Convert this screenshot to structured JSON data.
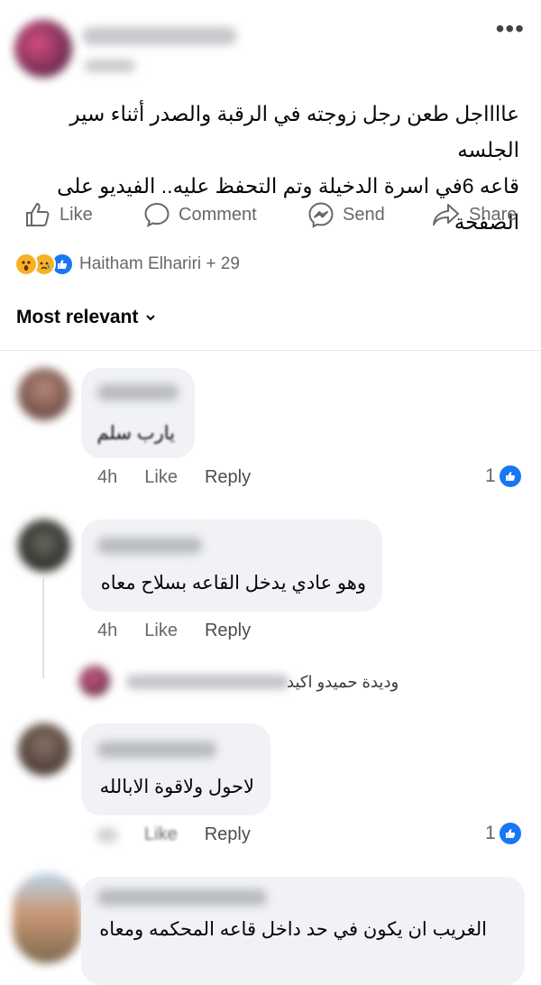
{
  "post": {
    "text_line1": "عااااجل طعن رجل زوجته في الرقبة والصدر أثناء سير الجلسه",
    "text_line2": "قاعه 6في اسرة الدخيلة وتم التحفظ عليه.. الفيديو على الصفحة",
    "more_label": "•••"
  },
  "actions": {
    "like": "Like",
    "comment": "Comment",
    "send": "Send",
    "share": "Share"
  },
  "reactions": {
    "summary": "Haitham Elhariri + 29",
    "icons": [
      "wow-icon",
      "sad-icon",
      "like-icon"
    ]
  },
  "sort": {
    "label": "Most relevant"
  },
  "comments": [
    {
      "text": "يارب سلم",
      "time": "4h",
      "like": "Like",
      "reply": "Reply",
      "likes": "1"
    },
    {
      "text": "وهو عادي يدخل القاعه بسلاح معاه",
      "time": "4h",
      "like": "Like",
      "reply": "Reply",
      "reply_preview": "وديدة حميدو اكيد"
    },
    {
      "text": "لاحول ولاقوة الابالله",
      "like": "Like",
      "reply": "Reply",
      "likes": "1"
    },
    {
      "text": "الغريب ان يكون في حد داخل قاعه المحكمه ومعاه"
    }
  ],
  "colors": {
    "brand_blue": "#1877f2",
    "muted_text": "#65676b",
    "bubble_bg": "#f0f2f5"
  }
}
